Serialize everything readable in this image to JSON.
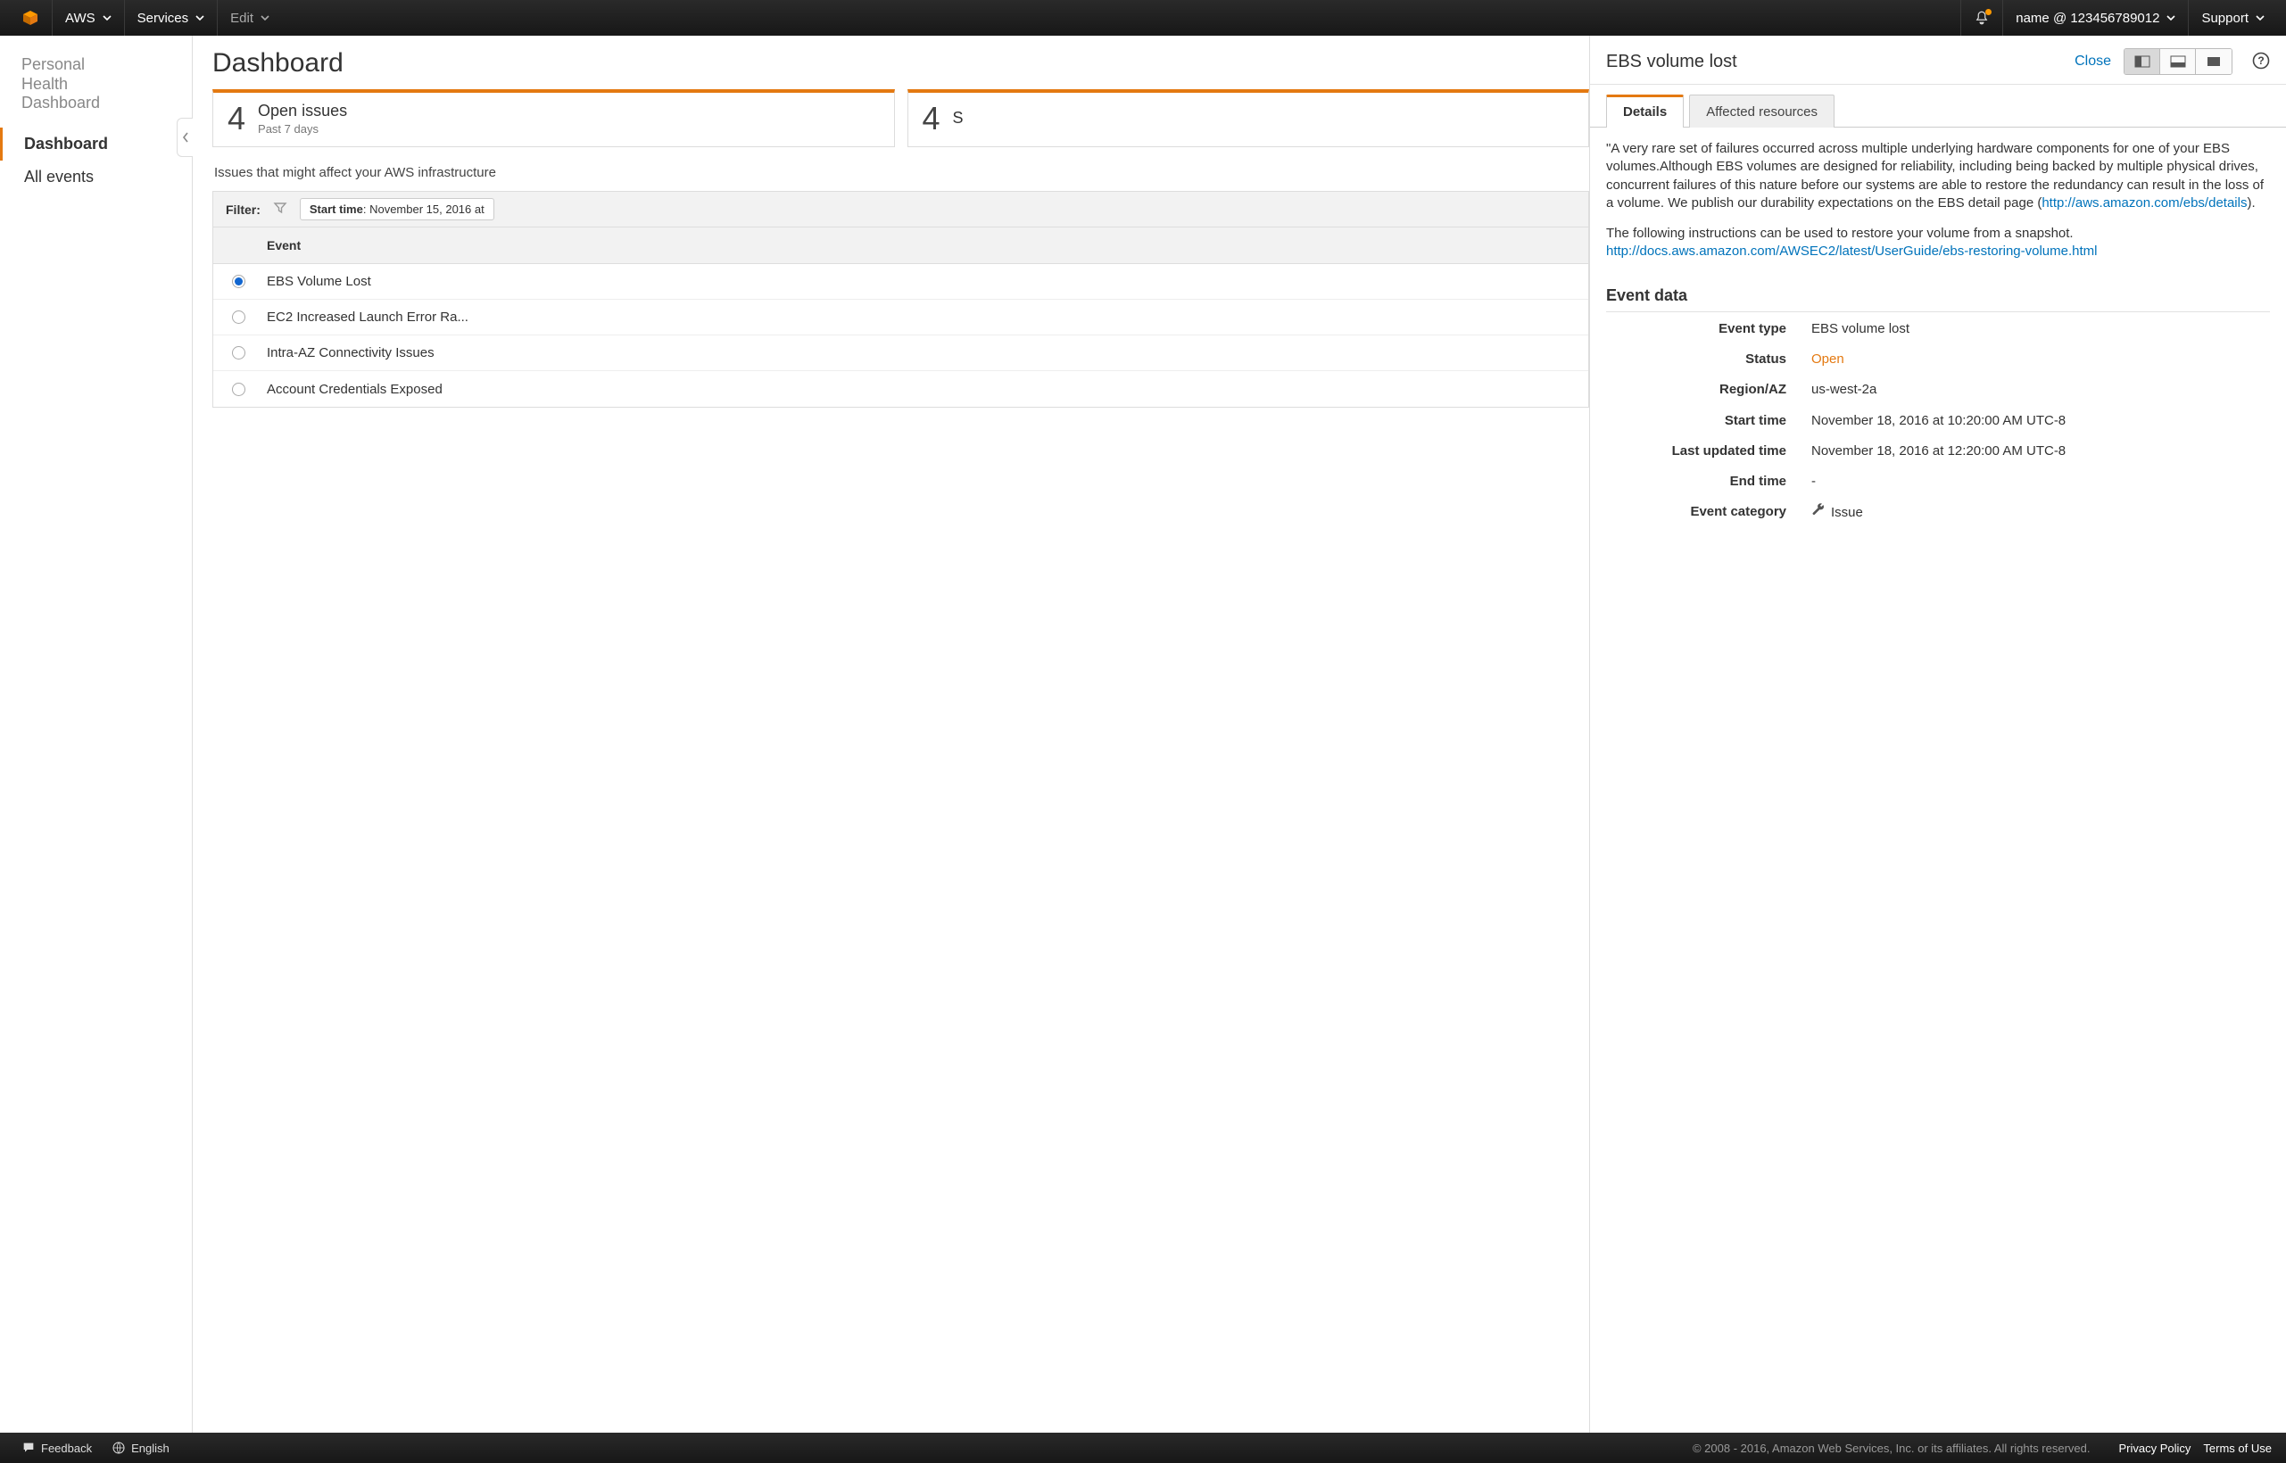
{
  "topnav": {
    "aws_label": "AWS",
    "services_label": "Services",
    "edit_label": "Edit",
    "account_label": "name @ 123456789012",
    "support_label": "Support"
  },
  "sidebar": {
    "title_line1": "Personal",
    "title_line2": "Health",
    "title_line3": "Dashboard",
    "items": [
      {
        "label": "Dashboard",
        "active": true
      },
      {
        "label": "All events",
        "active": false
      }
    ]
  },
  "dashboard": {
    "heading": "Dashboard",
    "cards": [
      {
        "count": "4",
        "title": "Open issues",
        "subtitle": "Past 7 days"
      },
      {
        "count": "4",
        "title": "S",
        "subtitle": ""
      }
    ],
    "description": "Issues that might affect your AWS infrastructure",
    "filter": {
      "label": "Filter:",
      "chip_key": "Start time",
      "chip_value": ": November 15, 2016 at"
    },
    "table": {
      "header_event": "Event",
      "rows": [
        {
          "selected": true,
          "event": "EBS Volume Lost"
        },
        {
          "selected": false,
          "event": "EC2 Increased Launch Error Ra..."
        },
        {
          "selected": false,
          "event": "Intra-AZ Connectivity Issues"
        },
        {
          "selected": false,
          "event": "Account Credentials Exposed"
        }
      ]
    }
  },
  "detail": {
    "title": "EBS volume lost",
    "close_label": "Close",
    "tabs": [
      {
        "label": "Details",
        "active": true
      },
      {
        "label": "Affected resources",
        "active": false
      }
    ],
    "body": {
      "para1_pre": "\"A very rare set of failures occurred across multiple underlying hardware components for one of your EBS volumes.Although EBS volumes are designed for reliability, including being backed by multiple physical drives, concurrent failures of this nature before our systems are able to restore the redundancy can result in the loss of a volume. We publish our durability expectations on the EBS detail page (",
      "para1_link": "http://aws.amazon.com/ebs/details",
      "para1_post": ").",
      "para2": "The following instructions can be used to restore your volume from a snapshot.",
      "para2_link": "http://docs.aws.amazon.com/AWSEC2/latest/UserGuide/ebs-restoring-volume.html"
    },
    "event_data_heading": "Event data",
    "kv": {
      "event_type_k": "Event type",
      "event_type_v": "EBS volume lost",
      "status_k": "Status",
      "status_v": "Open",
      "region_k": "Region/AZ",
      "region_v": "us-west-2a",
      "start_k": "Start time",
      "start_v": "November 18, 2016 at 10:20:00 AM UTC-8",
      "updated_k": "Last updated time",
      "updated_v": "November 18, 2016 at 12:20:00 AM UTC-8",
      "end_k": "End time",
      "end_v": "-",
      "cat_k": "Event category",
      "cat_v": "Issue"
    }
  },
  "footer": {
    "feedback": "Feedback",
    "language": "English",
    "copy": "© 2008 - 2016, Amazon Web Services, Inc. or its affiliates. All rights reserved.",
    "privacy": "Privacy Policy",
    "terms": "Terms of Use"
  }
}
